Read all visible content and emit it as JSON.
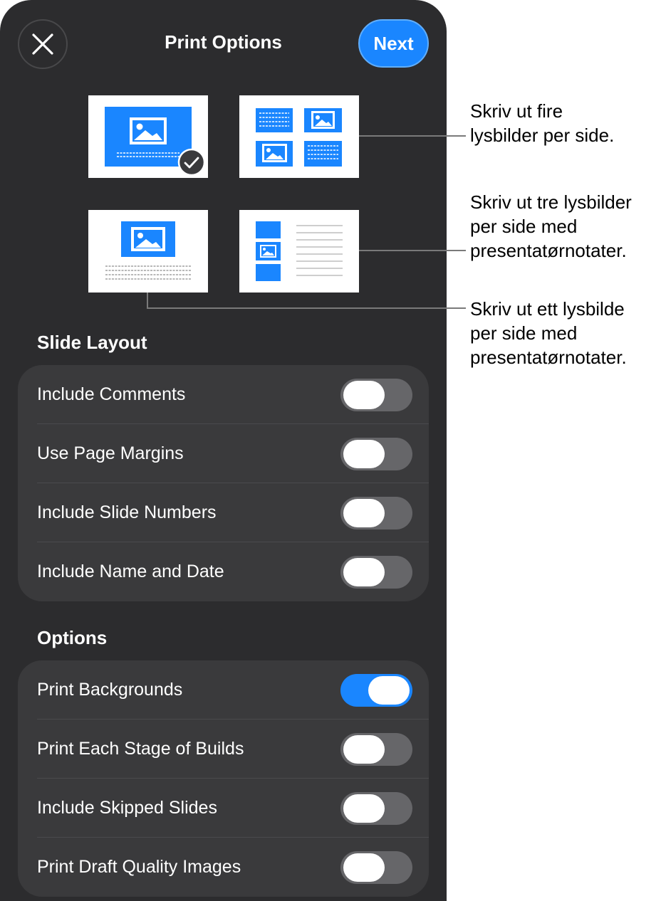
{
  "header": {
    "title": "Print Options",
    "next_label": "Next"
  },
  "layouts": {
    "selected": "one-slide",
    "items": [
      "one-slide",
      "four-slides",
      "one-slide-with-notes",
      "three-slides-with-notes"
    ]
  },
  "slide_layout": {
    "heading": "Slide Layout",
    "rows": [
      {
        "label": "Include Comments",
        "on": false
      },
      {
        "label": "Use Page Margins",
        "on": false
      },
      {
        "label": "Include Slide Numbers",
        "on": false
      },
      {
        "label": "Include Name and Date",
        "on": false
      }
    ]
  },
  "options": {
    "heading": "Options",
    "rows": [
      {
        "label": "Print Backgrounds",
        "on": true
      },
      {
        "label": "Print Each Stage of Builds",
        "on": false
      },
      {
        "label": "Include Skipped Slides",
        "on": false
      },
      {
        "label": "Print Draft Quality Images",
        "on": false
      }
    ]
  },
  "callouts": {
    "four": [
      "Skriv ut fire",
      "lysbilder per side."
    ],
    "three_notes": [
      "Skriv ut tre lysbilder",
      "per side med",
      "presentatørnotater."
    ],
    "one_notes": [
      "Skriv ut ett lysbilde",
      "per side med",
      "presentatørnotater."
    ]
  },
  "colors": {
    "accent": "#1a86ff",
    "panel": "#2c2c2e",
    "group": "#3a3a3c"
  }
}
